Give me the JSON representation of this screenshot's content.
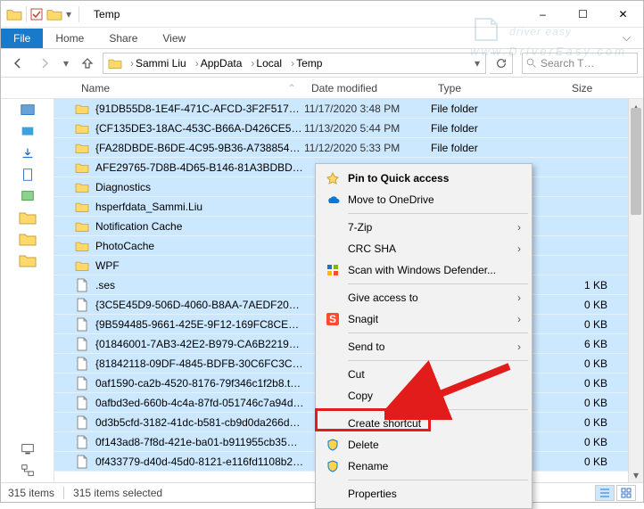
{
  "window": {
    "title": "Temp",
    "winctrl": {
      "min": "–",
      "max": "☐",
      "close": "✕"
    }
  },
  "tabs": {
    "file": "File",
    "home": "Home",
    "share": "Share",
    "view": "View"
  },
  "breadcrumbs": [
    "Sammi Liu",
    "AppData",
    "Local",
    "Temp"
  ],
  "search_placeholder": "Search T…",
  "columns": {
    "name": "Name",
    "date": "Date modified",
    "type": "Type",
    "size": "Size"
  },
  "files": [
    {
      "icon": "folder",
      "name": "{91DB55D8-1E4F-471C-AFCD-3F2F517B2…",
      "date": "11/17/2020 3:48 PM",
      "type": "File folder",
      "size": ""
    },
    {
      "icon": "folder",
      "name": "{CF135DE3-18AC-453C-B66A-D426CE52E…",
      "date": "11/13/2020 5:44 PM",
      "type": "File folder",
      "size": ""
    },
    {
      "icon": "folder",
      "name": "{FA28DBDE-B6DE-4C95-9B36-A73885486…",
      "date": "11/12/2020 5:33 PM",
      "type": "File folder",
      "size": ""
    },
    {
      "icon": "folder",
      "name": "AFE29765-7D8B-4D65-B146-81A3BDBD00…",
      "date": "",
      "type": "",
      "size": ""
    },
    {
      "icon": "folder",
      "name": "Diagnostics",
      "date": "",
      "type": "",
      "size": ""
    },
    {
      "icon": "folder",
      "name": "hsperfdata_Sammi.Liu",
      "date": "",
      "type": "",
      "size": ""
    },
    {
      "icon": "folder",
      "name": "Notification Cache",
      "date": "",
      "type": "",
      "size": ""
    },
    {
      "icon": "folder",
      "name": "PhotoCache",
      "date": "",
      "type": "",
      "size": ""
    },
    {
      "icon": "folder",
      "name": "WPF",
      "date": "",
      "type": "",
      "size": ""
    },
    {
      "icon": "file",
      "name": ".ses",
      "date": "",
      "type": "",
      "size": "1 KB"
    },
    {
      "icon": "file",
      "name": "{3C5E45D9-506D-4060-B8AA-7AEDF206B…",
      "date": "",
      "type": "",
      "size": "0 KB"
    },
    {
      "icon": "file",
      "name": "{9B594485-9661-425E-9F12-169FC8CE21E…",
      "date": "",
      "type": "",
      "size": "0 KB"
    },
    {
      "icon": "file",
      "name": "{01846001-7AB3-42E2-B979-CA6B221908…",
      "date": "",
      "type": "",
      "size": "6 KB"
    },
    {
      "icon": "file",
      "name": "{81842118-09DF-4845-BDFB-30C6FC3C28…",
      "date": "",
      "type": "",
      "size": "0 KB"
    },
    {
      "icon": "file",
      "name": "0af1590-ca2b-4520-8176-79f346c1f2b8.t…",
      "date": "",
      "type": "",
      "size": "0 KB"
    },
    {
      "icon": "file",
      "name": "0afbd3ed-660b-4c4a-87fd-051746c7a94d…",
      "date": "",
      "type": "",
      "size": "0 KB"
    },
    {
      "icon": "file",
      "name": "0d3b5cfd-3182-41dc-b581-cb9d0da266d…",
      "date": "",
      "type": "",
      "size": "0 KB"
    },
    {
      "icon": "file",
      "name": "0f143ad8-7f8d-421e-ba01-b911955cb35…",
      "date": "",
      "type": "",
      "size": "0 KB"
    },
    {
      "icon": "file",
      "name": "0f433779-d40d-45d0-8121-e116fd1108b2…",
      "date": "",
      "type": "",
      "size": "0 KB"
    }
  ],
  "context_menu": {
    "pin": "Pin to Quick access",
    "onedrive": "Move to OneDrive",
    "sevenzip": "7-Zip",
    "crcsha": "CRC SHA",
    "defender": "Scan with Windows Defender...",
    "giveaccess": "Give access to",
    "snagit": "Snagit",
    "sendto": "Send to",
    "cut": "Cut",
    "copy": "Copy",
    "shortcut": "Create shortcut",
    "delete": "Delete",
    "rename": "Rename",
    "properties": "Properties"
  },
  "status": {
    "items": "315 items",
    "selected": "315 items selected"
  },
  "watermark": {
    "main": "driver easy",
    "sub": "www.DriverEasy.com"
  }
}
